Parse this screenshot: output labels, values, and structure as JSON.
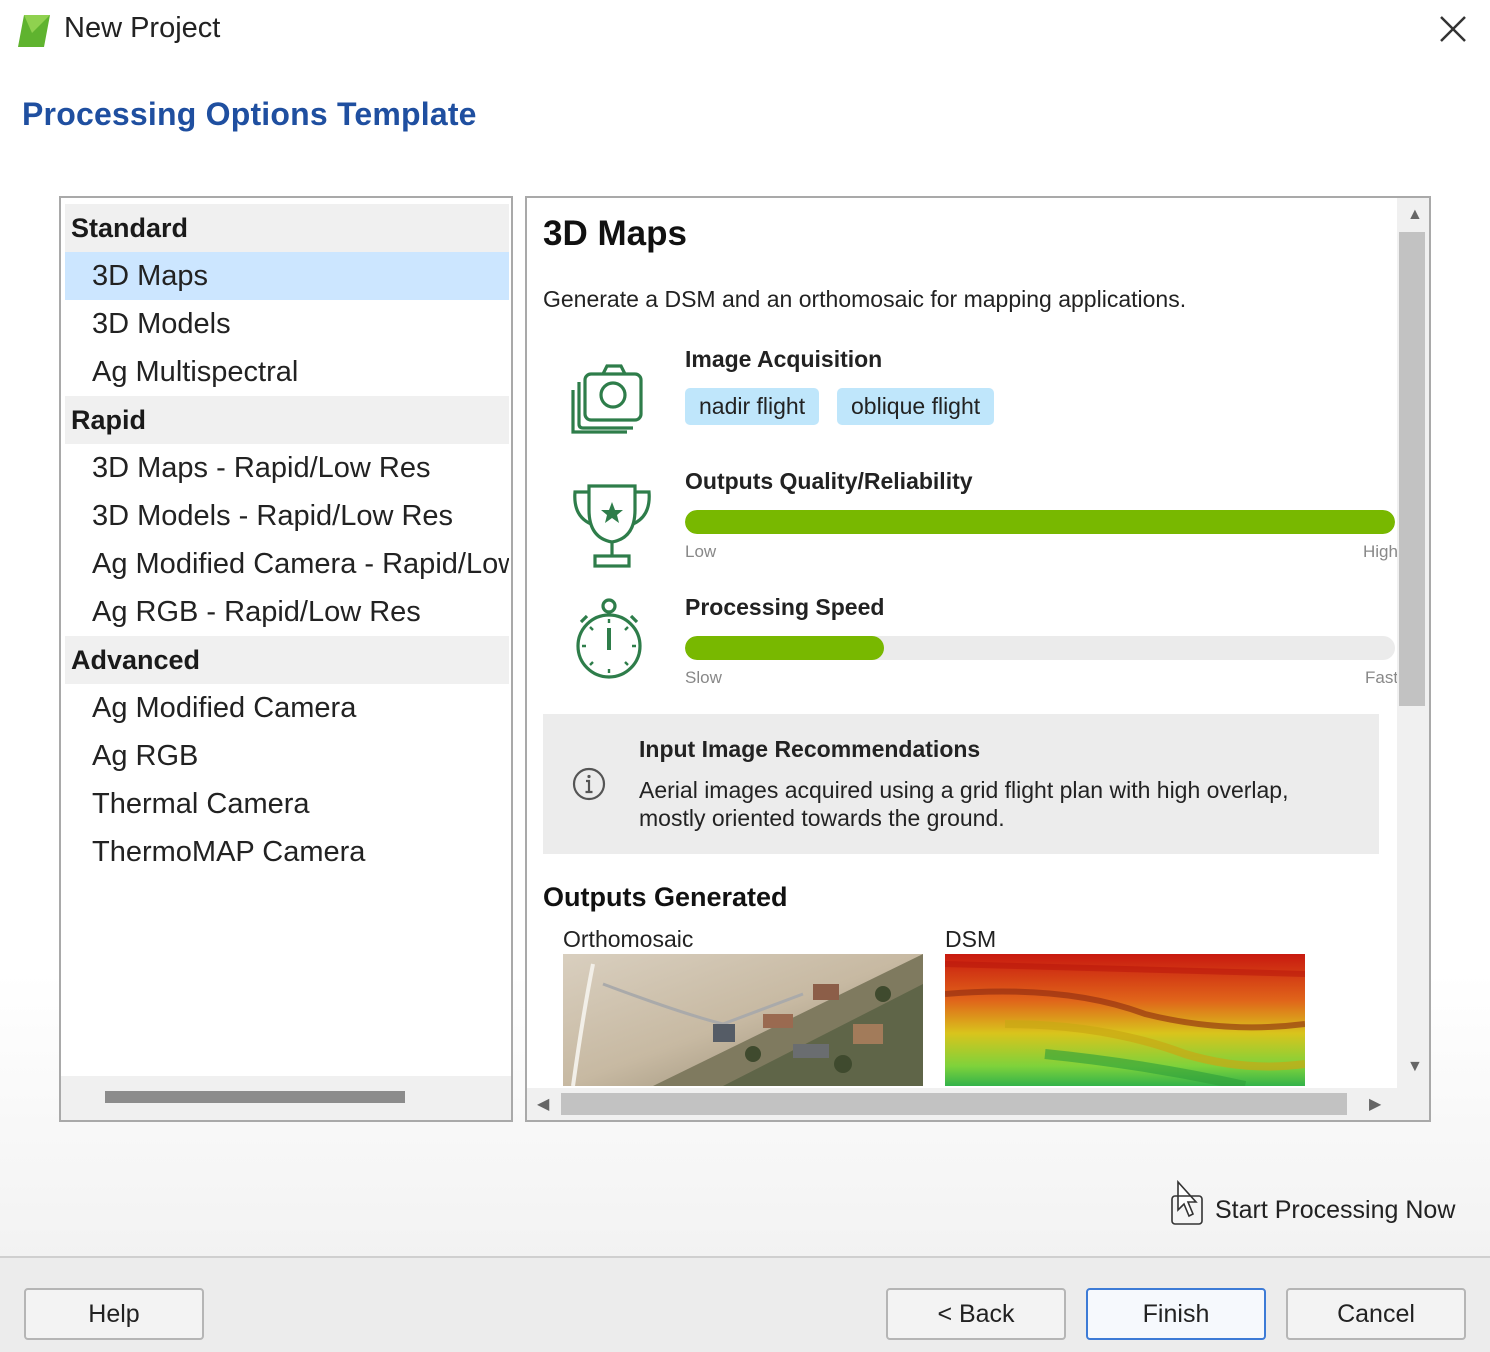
{
  "window": {
    "title": "New Project",
    "close_icon": "close-icon"
  },
  "heading": "Processing Options Template",
  "template_list": {
    "groups": [
      {
        "label": "Standard",
        "items": [
          "3D Maps",
          "3D Models",
          "Ag Multispectral"
        ]
      },
      {
        "label": "Rapid",
        "items": [
          "3D Maps - Rapid/Low Res",
          "3D Models - Rapid/Low Res",
          "Ag Modified Camera - Rapid/Low Res",
          "Ag RGB - Rapid/Low Res"
        ]
      },
      {
        "label": "Advanced",
        "items": [
          "Ag Modified Camera",
          "Ag RGB",
          "Thermal Camera",
          "ThermoMAP Camera"
        ]
      }
    ],
    "selected": "3D Maps"
  },
  "detail": {
    "title": "3D Maps",
    "description": "Generate a DSM and an orthomosaic for mapping applications.",
    "image_acquisition": {
      "label": "Image Acquisition",
      "icon": "camera-stack-icon",
      "tags": [
        "nadir flight",
        "oblique flight"
      ]
    },
    "quality": {
      "label": "Outputs Quality/Reliability",
      "icon": "trophy-icon",
      "value_fraction": 1.0,
      "low_label": "Low",
      "high_label": "High"
    },
    "speed": {
      "label": "Processing Speed",
      "icon": "stopwatch-icon",
      "value_fraction": 0.28,
      "low_label": "Slow",
      "high_label": "Fast"
    },
    "recommendation": {
      "title": "Input Image Recommendations",
      "icon": "info-icon",
      "text": "Aerial images acquired using a grid flight plan with high overlap, mostly oriented towards the ground."
    },
    "outputs": {
      "title": "Outputs Generated",
      "items": [
        {
          "label": "Orthomosaic",
          "thumb": "orthomosaic-thumbnail"
        },
        {
          "label": "DSM",
          "thumb": "dsm-thumbnail"
        }
      ]
    }
  },
  "start_processing": {
    "label": "Start Processing Now",
    "checked": false
  },
  "buttons": {
    "help": "Help",
    "back": "< Back",
    "finish": "Finish",
    "cancel": "Cancel"
  },
  "colors": {
    "heading": "#1f4fa0",
    "selection": "#cce6ff",
    "tag": "#bfe6fb",
    "bar_fill": "#78b800"
  }
}
